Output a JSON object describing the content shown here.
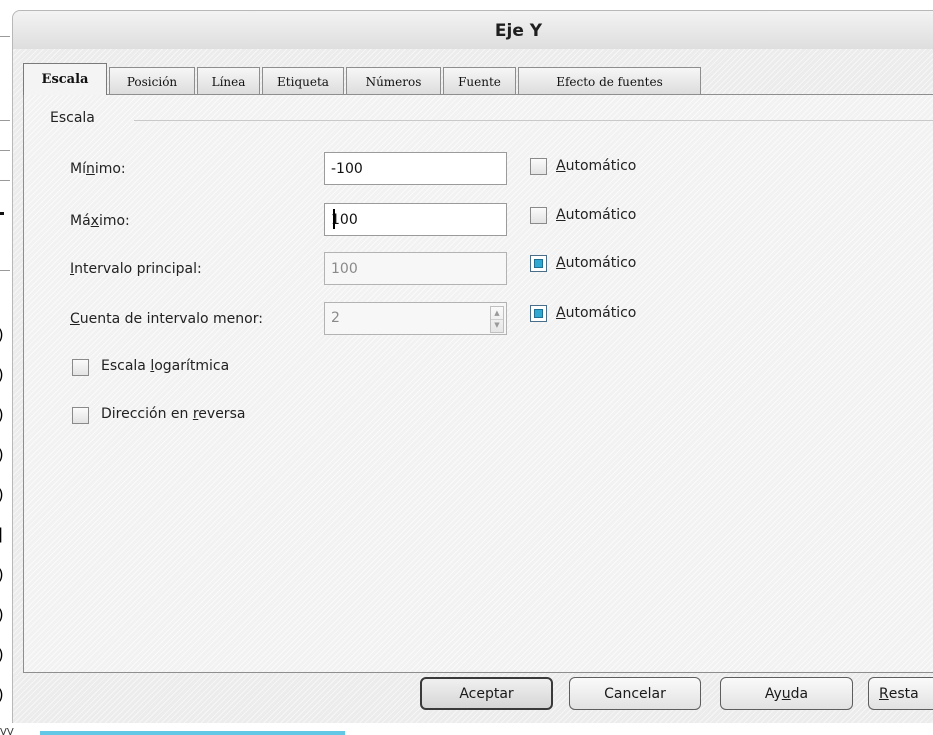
{
  "dialog": {
    "title": "Eje Y"
  },
  "tabs": [
    {
      "label": "Escala",
      "active": true
    },
    {
      "label": "Posición",
      "active": false
    },
    {
      "label": "Línea",
      "active": false
    },
    {
      "label": "Etiqueta",
      "active": false
    },
    {
      "label": "Números",
      "active": false
    },
    {
      "label": "Fuente",
      "active": false
    },
    {
      "label": "Efecto de fuentes",
      "active": false
    }
  ],
  "scale_group": {
    "title": "Escala",
    "minimum": {
      "label_pre": "Mí",
      "label_key": "n",
      "label_post": "imo:",
      "value": "-100",
      "auto_label_key": "A",
      "auto_label_rest": "utomático",
      "auto_checked": false
    },
    "maximum": {
      "label_pre": "Má",
      "label_key": "x",
      "label_post": "imo:",
      "value": "100",
      "auto_label_key": "A",
      "auto_label_rest": "utomático",
      "auto_checked": false
    },
    "major_interval": {
      "label_key": "I",
      "label_post": "ntervalo principal:",
      "value": "100",
      "auto_label_key": "A",
      "auto_label_rest": "utomático",
      "auto_checked": true
    },
    "minor_interval_count": {
      "label_key": "C",
      "label_post": "uenta de intervalo menor:",
      "value": "2",
      "auto_label_key": "A",
      "auto_label_rest": "utomático",
      "auto_checked": true
    },
    "logarithmic": {
      "label_pre": "Escala ",
      "label_key": "l",
      "label_post": "ogarítmica",
      "checked": false
    },
    "reverse": {
      "label_pre": "Dirección en ",
      "label_key": "r",
      "label_post": "eversa",
      "checked": false
    }
  },
  "buttons": {
    "ok": "Aceptar",
    "cancel": "Cancelar",
    "help_pre": "Ay",
    "help_key": "u",
    "help_post": "da",
    "reset_key": "R",
    "reset_post": "esta"
  },
  "background": {
    "parens": [
      ")",
      ")",
      ")",
      ")",
      ")",
      "]",
      ")",
      ")",
      ")",
      ")"
    ],
    "bottom_text": "VV"
  },
  "colors": {
    "accent_checked": "#2fa9d2",
    "taskbar_blue": "#63c8e6"
  }
}
